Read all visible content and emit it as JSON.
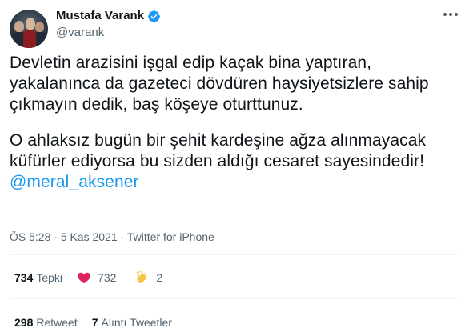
{
  "author": {
    "name": "Mustafa Varank",
    "handle": "@varank",
    "verified_color": "#1d9bf0"
  },
  "tweet": {
    "paragraph1": [
      "Devletin arazisini işgal edip kaçak bina yaptıran,",
      "yakalanınca da gazeteci dövdüren haysiyetsizlere sahip",
      "çıkmayın dedik, baş köşeye oturttunuz."
    ],
    "paragraph2": [
      "O ahlaksız bugün bir şehit kardeşine ağza alınmayacak",
      "küfürler ediyorsa bu sizden aldığı cesaret sayesindedir!"
    ],
    "mention": "@meral_aksener"
  },
  "meta": {
    "time": "ÖS 5:28",
    "date": "5 Kas 2021",
    "source": "Twitter for iPhone",
    "separator": "·"
  },
  "reactions": {
    "total": "734",
    "total_label": "Tepki",
    "likes": "732",
    "claps": "2",
    "like_color": "#e0245e"
  },
  "shares": {
    "retweets": "298",
    "retweets_label": "Retweet",
    "quotes": "7",
    "quotes_label": "Alıntı Tweetler"
  }
}
